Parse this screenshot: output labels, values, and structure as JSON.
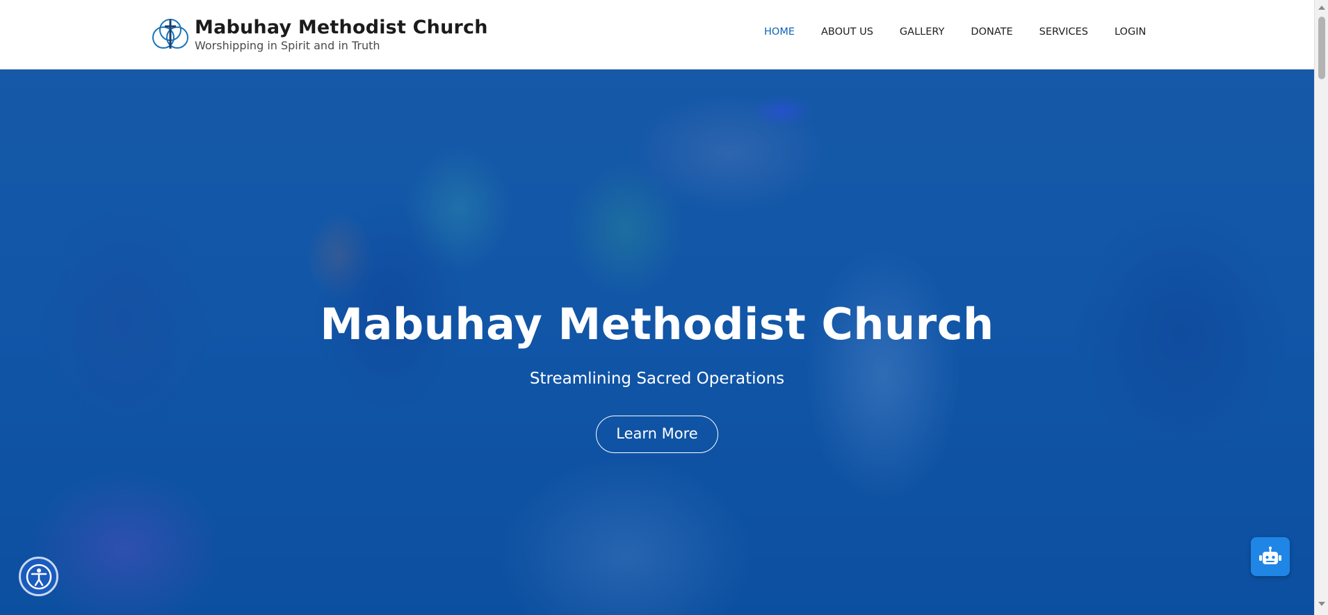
{
  "header": {
    "brand_title": "Mabuhay Methodist Church",
    "tagline": "Worshipping in Spirit and in Truth",
    "logo_icon": "cross-in-circles-icon"
  },
  "nav": {
    "items": [
      {
        "label": "HOME",
        "active": true
      },
      {
        "label": "ABOUT US",
        "active": false
      },
      {
        "label": "GALLERY",
        "active": false
      },
      {
        "label": "DONATE",
        "active": false
      },
      {
        "label": "SERVICES",
        "active": false
      },
      {
        "label": "LOGIN",
        "active": false
      }
    ]
  },
  "hero": {
    "title": "Mabuhay Methodist Church",
    "subtitle": "Streamlining Sacred Operations",
    "cta_label": "Learn More",
    "background": "blurred-congregation-photo-blue-overlay"
  },
  "widgets": {
    "accessibility_icon": "accessibility-icon",
    "chatbot_icon": "robot-icon"
  },
  "colors": {
    "accent": "#0f63b5",
    "overlay_blue": "#0f4f9c",
    "chatbot_button": "#1f86e6",
    "accessibility_button": "#1a5bbd"
  }
}
